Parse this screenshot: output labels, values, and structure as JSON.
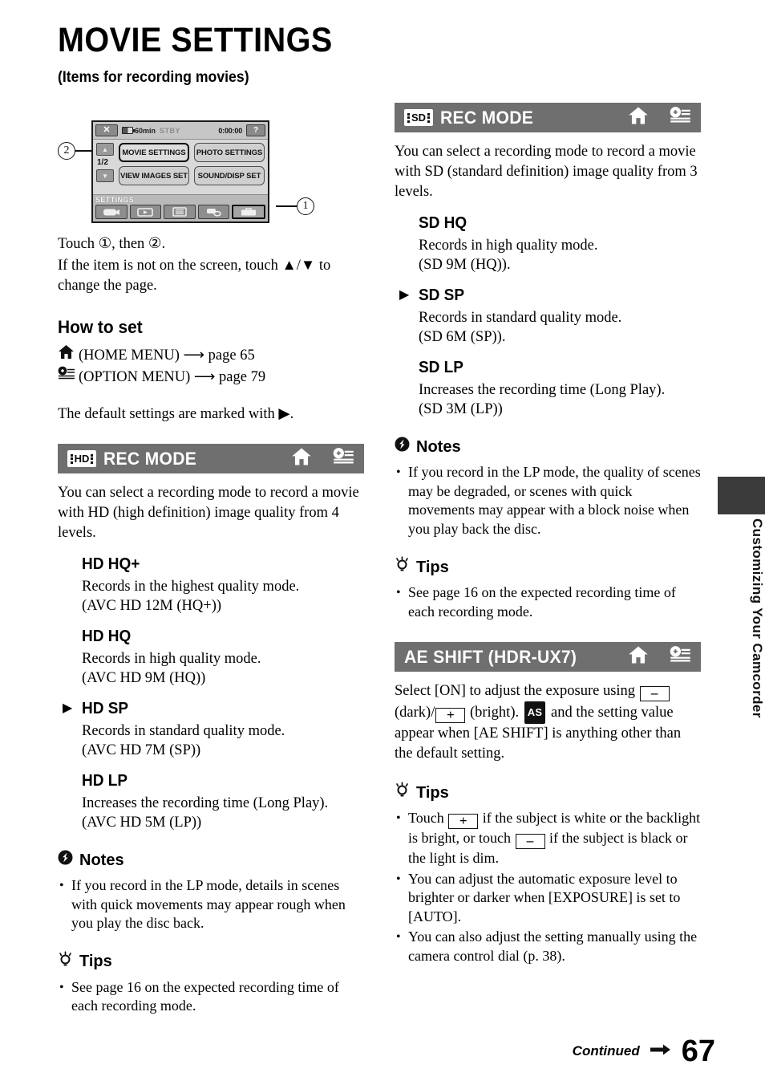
{
  "page": {
    "title": "MOVIE SETTINGS",
    "subtitle": "(Items for recording movies)",
    "number": "67",
    "continued_label": "Continued",
    "side_tab_label": "Customizing Your Camcorder"
  },
  "lcd": {
    "close_label": "✕",
    "battery_time": "60min",
    "status": "STBY",
    "timecode": "0:00:00",
    "help_label": "?",
    "up_arrow": "▲",
    "down_arrow": "▼",
    "page_indicator": "1/2",
    "buttons": [
      "MOVIE SETTINGS",
      "PHOTO SETTINGS",
      "VIEW IMAGES SET",
      "SOUND/DISP SET"
    ],
    "category_label": "SETTINGS",
    "category_icons": [
      "camera-icon",
      "playback-icon",
      "list-icon",
      "others-icon",
      "manage-media-icon"
    ],
    "callout_one": "1",
    "callout_two": "2"
  },
  "intro": {
    "touch_line": "Touch ①, then ②.",
    "hint_line": "If the item is not on the screen, touch ▲/▼ to change the page.",
    "how_to_set": "How to set",
    "home_menu": "(HOME MENU) ⟶ page 65",
    "option_menu": "(OPTION MENU) ⟶ page 79",
    "default_note": "The default settings are marked with ▶."
  },
  "sections": [
    {
      "badge": "HD",
      "title": "REC MODE",
      "intro": "You can select a recording mode to record a movie with HD (high definition) image quality from 4 levels.",
      "modes": [
        {
          "name": "HD HQ+",
          "default": false,
          "desc": "Records in the highest quality mode.",
          "spec": "(AVC HD 12M (HQ+))"
        },
        {
          "name": "HD HQ",
          "default": false,
          "desc": "Records in high quality mode.",
          "spec": "(AVC HD 9M (HQ))"
        },
        {
          "name": "HD SP",
          "default": true,
          "desc": "Records in standard quality mode.",
          "spec": "(AVC HD 7M (SP))"
        },
        {
          "name": "HD LP",
          "default": false,
          "desc": "Increases the recording time (Long Play).",
          "spec": "(AVC HD 5M (LP))"
        }
      ],
      "notes_label": "Notes",
      "notes": [
        "If you record in the LP mode, details in scenes with quick movements may appear rough when you play the disc back."
      ],
      "tips_label": "Tips",
      "tips": [
        "See page 16 on the expected recording time of each recording mode."
      ]
    },
    {
      "badge": "SD",
      "title": "REC MODE",
      "intro": "You can select a recording mode to record a movie with SD (standard definition) image quality from 3 levels.",
      "modes": [
        {
          "name": "SD HQ",
          "default": false,
          "desc": "Records in high quality mode.",
          "spec": "(SD 9M (HQ))."
        },
        {
          "name": "SD SP",
          "default": true,
          "desc": "Records in standard quality mode.",
          "spec": "(SD 6M (SP))."
        },
        {
          "name": "SD LP",
          "default": false,
          "desc": "Increases the recording time (Long Play).",
          "spec": "(SD 3M (LP))"
        }
      ],
      "notes_label": "Notes",
      "notes": [
        "If you record in the LP mode, the quality of scenes may be degraded, or scenes with quick movements may appear with a block noise when you play back the disc."
      ],
      "tips_label": "Tips",
      "tips": [
        "See page 16 on the expected recording time of each recording mode."
      ]
    }
  ],
  "ae_shift": {
    "title": "AE SHIFT (HDR-UX7)",
    "body_1": "Select [ON] to adjust the exposure using",
    "key_minus": "–",
    "body_2": "(dark)/",
    "key_plus": "+",
    "body_3": "(bright).",
    "as_badge": "AS",
    "body_4": "and the setting value appear when [AE SHIFT] is anything other than the default setting.",
    "tips_label": "Tips",
    "tip_1_a": "Touch",
    "tip_1_b": "if the subject is white or the backlight is bright, or touch",
    "tip_1_c": "if the subject is black or the light is dim.",
    "tip_2": "You can adjust the automatic exposure level to brighter or darker when [EXPOSURE] is set to [AUTO].",
    "tip_3": "You can also adjust the setting manually using the camera control dial (p. 38)."
  },
  "icons": {
    "home": "home-icon",
    "option": "option-menu-icon",
    "notes": "notes-warning-icon",
    "tips": "tips-lightbulb-icon"
  }
}
